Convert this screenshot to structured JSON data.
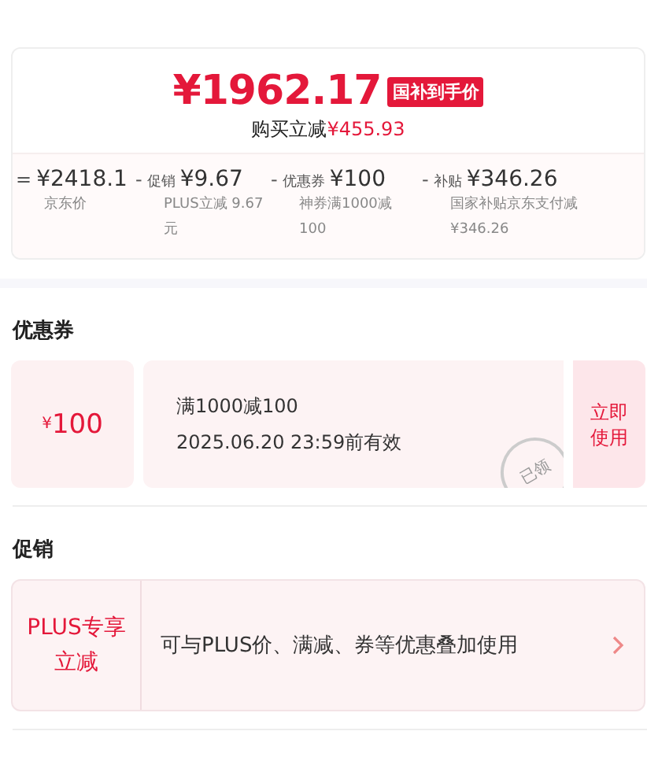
{
  "price_card": {
    "final_price": "¥1962.17",
    "badge": "国补到手价",
    "saving_label": "购买立减",
    "saving_amount": "¥455.93",
    "breakdown": [
      {
        "operator": "=",
        "amount": "¥2418.1",
        "note": "京东价"
      },
      {
        "operator": "-",
        "label": "促销",
        "amount": "¥9.67",
        "note": "PLUS立减 9.67元"
      },
      {
        "operator": "-",
        "label": "优惠券",
        "amount": "¥100",
        "note": "神券满1000减100"
      },
      {
        "operator": "-",
        "label": "补贴",
        "amount": "¥346.26",
        "note": "国家补贴京东支付减¥346.26"
      }
    ]
  },
  "coupon_section": {
    "title": "优惠券",
    "coupon": {
      "currency": "¥",
      "value": "100",
      "condition": "满1000减100",
      "validity": "2025.06.20 23:59前有效",
      "stamp": "已领",
      "action": "立即使用"
    }
  },
  "promo_section": {
    "title": "促销",
    "promo": {
      "tag": "PLUS专享立减",
      "description": "可与PLUS价、满减、券等优惠叠加使用"
    }
  }
}
